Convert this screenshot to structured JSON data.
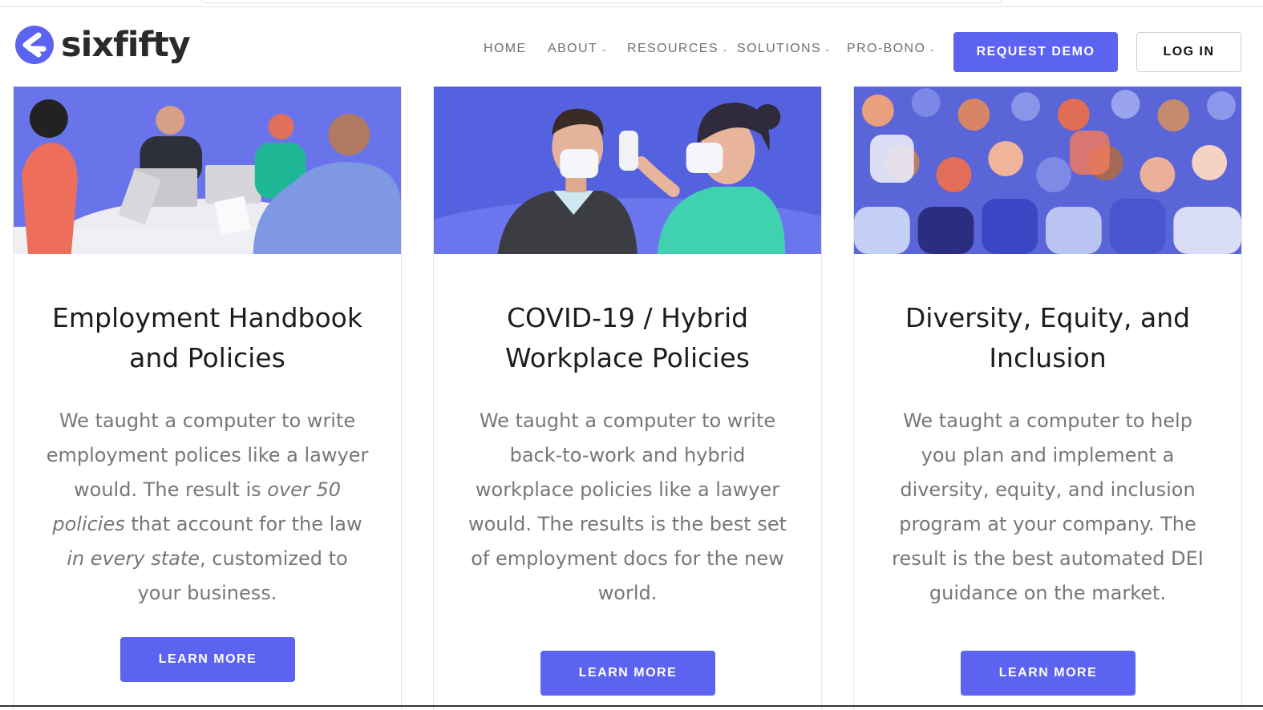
{
  "brand": {
    "name": "sixfifty",
    "accent": "#5b63f0",
    "text_color": "#2a2a2a"
  },
  "nav": {
    "items": [
      {
        "label": "HOME",
        "has_dropdown": false
      },
      {
        "label": "ABOUT",
        "has_dropdown": true
      },
      {
        "label": "RESOURCES",
        "has_dropdown": true
      },
      {
        "label": "SOLUTIONS",
        "has_dropdown": true
      },
      {
        "label": "PRO-BONO",
        "has_dropdown": true
      }
    ],
    "chevron": "⌄",
    "request_demo": "REQUEST DEMO",
    "login": "LOG IN"
  },
  "cards": [
    {
      "title": "Employment Handbook and Policies",
      "body": [
        {
          "text": "We taught a computer to write employment polices like a lawyer would. The result is ",
          "em": false
        },
        {
          "text": "over 50 policies",
          "em": true
        },
        {
          "text": " that account for the law ",
          "em": false
        },
        {
          "text": "in every state",
          "em": true
        },
        {
          "text": ", customized to your business.",
          "em": false
        }
      ],
      "button": "LEARN MORE",
      "illustration": "team-meeting-illustration"
    },
    {
      "title": "COVID-19 / Hybrid Workplace Policies",
      "body": [
        {
          "text": "We taught a computer to write back-to-work and hybrid workplace policies like a lawyer would. The results is the best set of employment docs for the new world.",
          "em": false
        }
      ],
      "button": "LEARN MORE",
      "illustration": "temperature-check-illustration"
    },
    {
      "title": "Diversity, Equity, and Inclusion",
      "body": [
        {
          "text": "We taught a computer to help you plan and implement a diversity, equity, and inclusion program at your company. The result is the best automated DEI guidance on the market.",
          "em": false
        }
      ],
      "button": "LEARN MORE",
      "illustration": "diverse-crowd-illustration"
    }
  ]
}
